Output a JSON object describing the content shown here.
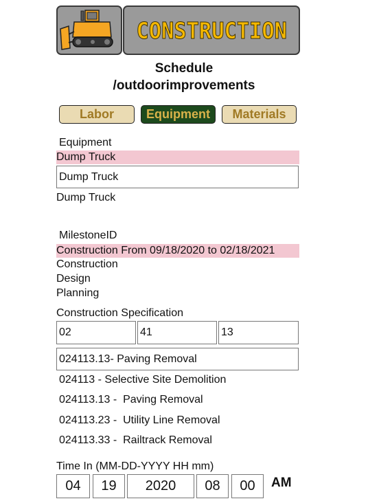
{
  "header": {
    "brand": "CONSTRUCTION",
    "logo_icon": "bulldozer-icon",
    "brand_color": "#f5b800"
  },
  "title": {
    "line1": "Schedule",
    "line2": "/outdoorimprovements"
  },
  "tabs": [
    {
      "label": "Labor",
      "active": false
    },
    {
      "label": "Equipment",
      "active": true
    },
    {
      "label": "Materials",
      "active": false
    }
  ],
  "equipment": {
    "label": "Equipment",
    "selected": "Dump Truck",
    "input_value": "Dump Truck",
    "options": [
      "Dump Truck"
    ]
  },
  "milestone": {
    "label": "MilestoneID",
    "selected": "Construction From 09/18/2020 to 02/18/2021",
    "options": [
      "Construction",
      "Design",
      "Planning"
    ]
  },
  "spec": {
    "label": "Construction Specification",
    "code_parts": [
      "02",
      "41",
      "13"
    ],
    "selected": "024113.13- Paving Removal",
    "options": [
      "024113 - Selective Site Demolition",
      "024113.13 -  Paving Removal",
      "024113.23 -  Utility Line Removal",
      "024113.33 -  Railtrack Removal"
    ]
  },
  "time_in": {
    "label": "Time In (MM-DD-YYYY HH mm)",
    "month": "04",
    "day": "19",
    "year": "2020",
    "hour": "08",
    "minute": "00",
    "ampm": "AM"
  },
  "colors": {
    "highlight": "#f3c7d1",
    "tab_active_bg": "#1d4a1d",
    "tab_inactive_bg": "#eadbb3"
  }
}
